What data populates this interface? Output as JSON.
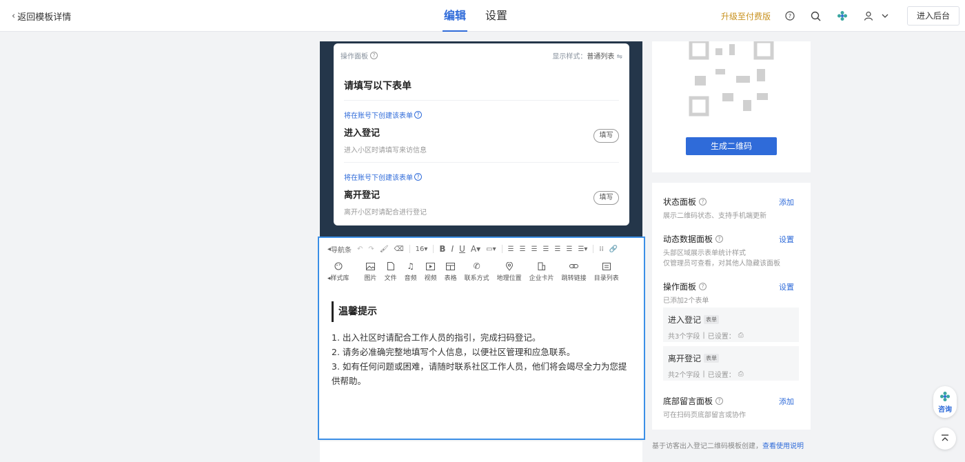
{
  "header": {
    "back_label": "返回模板详情",
    "tabs": [
      {
        "label": "编辑",
        "active": true
      },
      {
        "label": "设置",
        "active": false
      }
    ],
    "upgrade_label": "升级至付费版",
    "enter_backend_label": "进入后台",
    "icons": [
      "help-icon",
      "search-icon",
      "brand-logo-icon",
      "user-icon",
      "chevron-down-icon"
    ]
  },
  "operation_panel": {
    "title": "操作面板",
    "display_style_label": "显示样式：",
    "display_style_value": "普通列表",
    "form_title": "请填写以下表单",
    "forms": [
      {
        "hint": "将在账号下创建该表单",
        "name": "进入登记",
        "desc": "进入小区时请填写来访信息",
        "button": "填写"
      },
      {
        "hint": "将在账号下创建该表单",
        "name": "离开登记",
        "desc": "离开小区时请配合进行登记",
        "button": "填写"
      }
    ]
  },
  "editor": {
    "nav_label": "导航条",
    "font_size": "16",
    "style_lib_label": "样式库",
    "tools": [
      "图片",
      "文件",
      "音频",
      "视频",
      "表格",
      "联系方式",
      "地理位置",
      "企业卡片",
      "跳转链接",
      "目录列表"
    ],
    "tip_title": "温馨提示",
    "tip_lines": [
      "1. 出入社区时请配合工作人员的指引，完成扫码登记。",
      "2. 请务必准确完整地填写个人信息，以便社区管理和应急联系。",
      "3. 如有任何问题或困难，请随时联系社区工作人员，他们将会竭尽全力为您提供帮助。"
    ]
  },
  "qr": {
    "generate_label": "生成二维码"
  },
  "panels": {
    "status": {
      "name": "状态面板",
      "action": "添加",
      "desc": "展示二维码状态、支持手机端更新"
    },
    "dynamic": {
      "name": "动态数据面板",
      "action": "设置",
      "desc1": "头部区域展示表单统计样式",
      "desc2": "仅管理员可查看，对其他人隐藏该面板"
    },
    "operation": {
      "name": "操作面板",
      "action": "设置",
      "desc": "已添加2个表单"
    },
    "sub_forms": [
      {
        "name": "进入登记",
        "tag": "表单",
        "fields": "共3个字段",
        "settings": "已设置："
      },
      {
        "name": "离开登记",
        "tag": "表单",
        "fields": "共2个字段",
        "settings": "已设置："
      }
    ],
    "bottom_comment": {
      "name": "底部留言面板",
      "action": "添加",
      "desc": "可在扫码页底部留言或协作"
    }
  },
  "footnote": {
    "text": "基于访客出入登记二维码模板创建，",
    "link": "查看使用说明"
  },
  "consult_label": "咨询",
  "colors": {
    "accent": "#2f6bd9",
    "upgrade": "#c8911e",
    "preview_bg": "#24364a",
    "editor_border": "#3a8ee6"
  }
}
